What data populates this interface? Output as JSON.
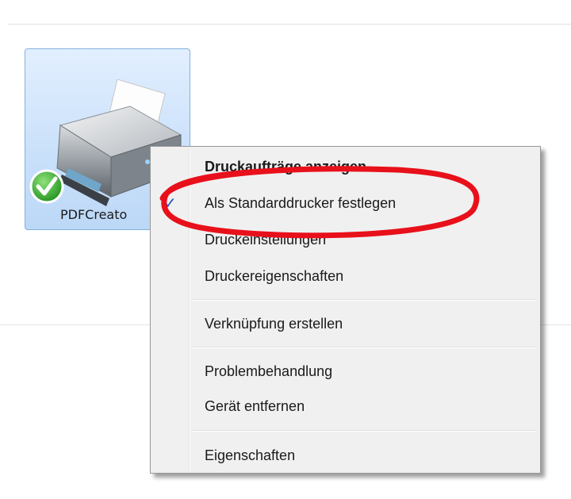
{
  "device": {
    "label": "PDFCreato",
    "status": "default-printer-check-icon"
  },
  "context_menu": {
    "items": [
      {
        "label": "Druckaufträge anzeigen",
        "bold": true
      },
      {
        "label": "Als Standarddrucker festlegen",
        "checked": true
      },
      {
        "label": "Druckeinstellungen"
      },
      {
        "label": "Druckereigenschaften"
      },
      {
        "label": "Verknüpfung erstellen"
      },
      {
        "label": "Problembehandlung"
      },
      {
        "label": "Gerät entfernen"
      },
      {
        "label": "Eigenschaften"
      }
    ],
    "check_glyph": "✓"
  },
  "colors": {
    "highlight_ellipse": "#e8101a",
    "tile_border": "#83b0dc",
    "check_blue": "#1e4fc9"
  }
}
